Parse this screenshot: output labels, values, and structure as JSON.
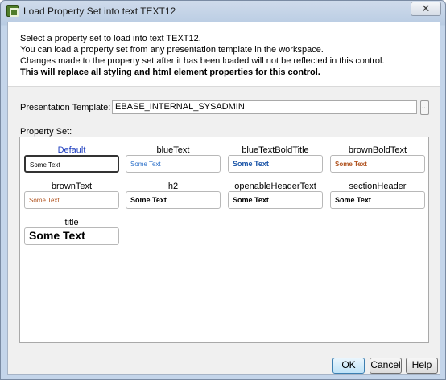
{
  "window": {
    "title": "Load Property Set into text TEXT12",
    "close_glyph": "✕"
  },
  "info": {
    "line1": "Select a property set to load into text TEXT12.",
    "line2": "You can load a property set from any presentation template in the workspace.",
    "line3": "Changes made to the property set after it has been loaded will not be reflected in this control.",
    "line4": "This will replace all styling and html element properties for this control."
  },
  "template": {
    "label": "Presentation Template:",
    "value": "EBASE_INTERNAL_SYSADMIN",
    "browse_label": "..."
  },
  "property_set": {
    "label": "Property Set:",
    "items": [
      {
        "name": "Default",
        "sample": "Some Text",
        "selected": true
      },
      {
        "name": "blueText",
        "sample": "Some Text"
      },
      {
        "name": "blueTextBoldTitle",
        "sample": "Some Text"
      },
      {
        "name": "brownBoldText",
        "sample": "Some Text"
      },
      {
        "name": "brownText",
        "sample": "Some Text"
      },
      {
        "name": "h2",
        "sample": "Some Text"
      },
      {
        "name": "openableHeaderText",
        "sample": "Some Text"
      },
      {
        "name": "sectionHeader",
        "sample": "Some Text"
      },
      {
        "name": "title",
        "sample": "Some Text"
      }
    ]
  },
  "buttons": {
    "ok": "OK",
    "cancel": "Cancel",
    "help": "Help"
  }
}
